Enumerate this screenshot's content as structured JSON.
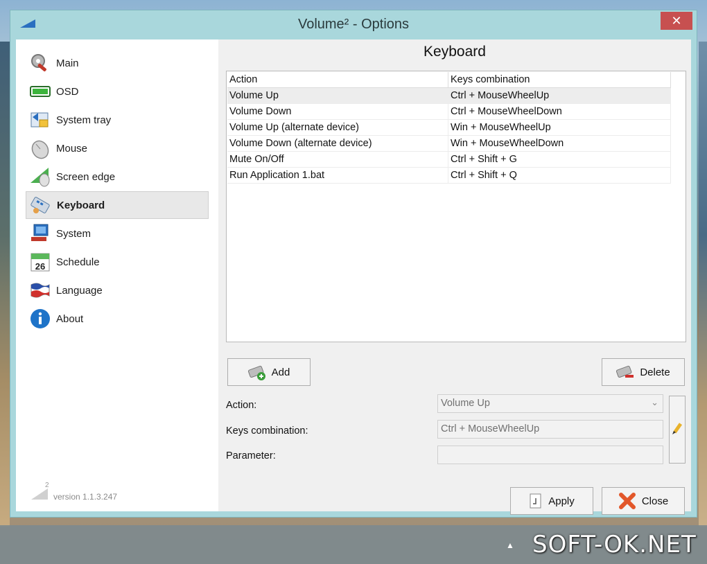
{
  "window": {
    "title": "Volume² - Options",
    "close_symbol": "✕"
  },
  "sidebar": {
    "items": [
      {
        "label": "Main",
        "icon": "wrench-gear-icon"
      },
      {
        "label": "OSD",
        "icon": "osd-bar-icon"
      },
      {
        "label": "System tray",
        "icon": "system-tray-icon"
      },
      {
        "label": "Mouse",
        "icon": "mouse-icon"
      },
      {
        "label": "Screen edge",
        "icon": "screen-edge-icon"
      },
      {
        "label": "Keyboard",
        "icon": "keyboard-icon",
        "active": true
      },
      {
        "label": "System",
        "icon": "computer-icon"
      },
      {
        "label": "Schedule",
        "icon": "calendar-icon",
        "calendar_day": "26"
      },
      {
        "label": "Language",
        "icon": "flag-icon"
      },
      {
        "label": "About",
        "icon": "info-icon"
      }
    ],
    "version": "version 1.1.3.247",
    "logo_superscript": "2"
  },
  "main": {
    "title": "Keyboard",
    "table": {
      "headers": [
        "Action",
        "Keys combination"
      ],
      "rows": [
        [
          "Volume Up",
          "Ctrl + MouseWheelUp"
        ],
        [
          "Volume Down",
          "Ctrl + MouseWheelDown"
        ],
        [
          "Volume Up (alternate device)",
          "Win + MouseWheelUp"
        ],
        [
          "Volume Down (alternate device)",
          "Win + MouseWheelDown"
        ],
        [
          "Mute On/Off",
          "Ctrl + Shift + G"
        ],
        [
          "Run Application 1.bat",
          "Ctrl + Shift + Q"
        ]
      ],
      "selected_row": 0
    },
    "add_label": "Add",
    "delete_label": "Delete",
    "form": {
      "action_label": "Action:",
      "action_value": "Volume Up",
      "keys_label": "Keys combination:",
      "keys_value": "Ctrl + MouseWheelUp",
      "parameter_label": "Parameter:",
      "parameter_value": ""
    },
    "apply_label": "Apply",
    "close_label": "Close"
  },
  "taskbar": {
    "watermark": "SOFT-OK.NET"
  }
}
